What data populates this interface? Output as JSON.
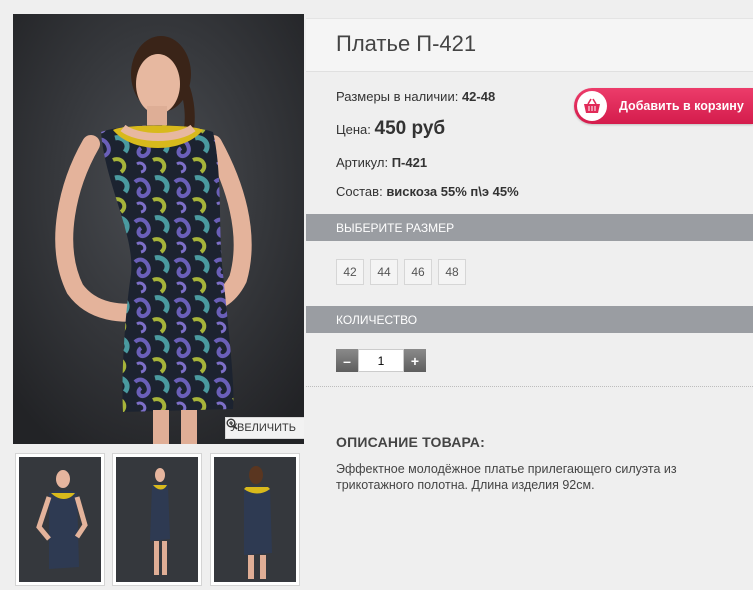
{
  "product": {
    "title": "Платье П-421",
    "sizes_available_label": "Размеры в наличии:",
    "sizes_available_value": "42-48",
    "price_label": "Цена:",
    "price_value": "450 руб",
    "article_label": "Артикул:",
    "article_value": "П-421",
    "composition_label": "Состав:",
    "composition_value": "вискоза 55% п\\э 45%"
  },
  "cart_button": {
    "label": "Добавить в корзину",
    "icon": "basket-icon",
    "color": "#e12a58"
  },
  "zoom": {
    "label": "УВЕЛИЧИТЬ",
    "icon": "magnifier-plus-icon"
  },
  "size_section": {
    "title": "ВЫБЕРИТЕ РАЗМЕР",
    "options": [
      "42",
      "44",
      "46",
      "48"
    ]
  },
  "quantity_section": {
    "title": "КОЛИЧЕСТВО",
    "minus": "–",
    "plus": "+",
    "value": "1"
  },
  "description": {
    "title": "ОПИСАНИЕ ТОВАРА:",
    "text": "Эффектное молодёжное платье прилегающего силуэта из трикотажного полотна. Длина изделия 92см."
  },
  "colors": {
    "section_bar": "#9a9da2",
    "dress_yellow": "#d8b91c",
    "photo_bg": "#2b2d31"
  }
}
